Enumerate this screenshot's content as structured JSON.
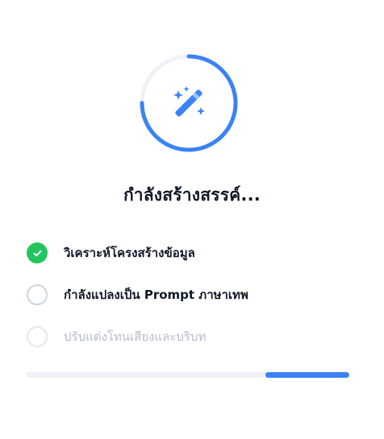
{
  "header": {
    "title": "กำลังสร้างสรรค์...",
    "icon": "magic-wand-icon",
    "ring_progress": 0.75
  },
  "steps": [
    {
      "label": "วิเคราะห์โครงสร้างข้อมูล",
      "status": "done",
      "icon": "check-icon"
    },
    {
      "label": "กำลังแปลงเป็น Prompt ภาษาเทพ",
      "status": "active"
    },
    {
      "label": "ปรับแต่งโทนเสียงและบริบท",
      "status": "pending"
    }
  ],
  "progress": {
    "start": 0.74,
    "end": 1.0
  },
  "colors": {
    "accent": "#3b82f6",
    "success": "#22c55e",
    "ring_track": "#eef2f7",
    "text_primary": "#111827",
    "text_muted": "#b6bcc8"
  }
}
